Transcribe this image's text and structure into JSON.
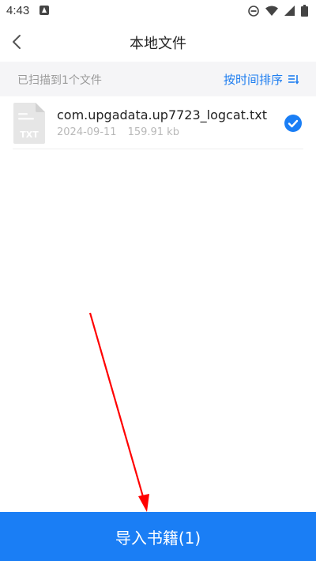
{
  "status_bar": {
    "time": "4:43",
    "icons": [
      "app-notification-icon",
      "do-not-disturb-icon",
      "wifi-icon",
      "signal-icon",
      "battery-icon"
    ]
  },
  "nav": {
    "title": "本地文件",
    "back_icon": "chevron-left-icon"
  },
  "scan_bar": {
    "count_text": "已扫描到1个文件",
    "sort_label": "按时间排序",
    "sort_icon": "sort-list-icon"
  },
  "files": [
    {
      "icon": "txt-file-icon",
      "icon_label": "TXT",
      "name": "com.upgadata.up7723_logcat.txt",
      "date": "2024-09-11",
      "size": "159.91 kb",
      "selected": true
    }
  ],
  "import_button": {
    "label": "导入书籍(1)"
  },
  "colors": {
    "accent": "#1a7ef5",
    "link": "#1f7ef0",
    "scan_bar_bg": "#f5f5f7",
    "annotation": "#ff0000"
  }
}
